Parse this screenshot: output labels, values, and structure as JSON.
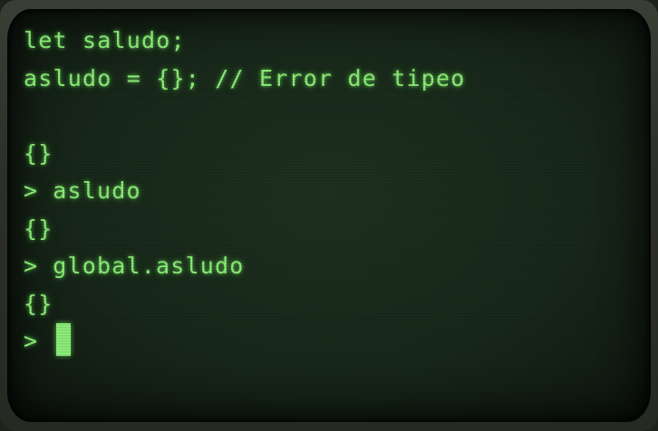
{
  "terminal": {
    "lines": [
      "let saludo;",
      "asludo = {}; // Error de tipeo",
      "",
      "{}",
      "asludo",
      "{}",
      "global.asludo",
      "{}"
    ],
    "prompt": ">",
    "input_value": "",
    "colors": {
      "phosphor": "#8ef07a",
      "screen": "#18281a"
    }
  }
}
